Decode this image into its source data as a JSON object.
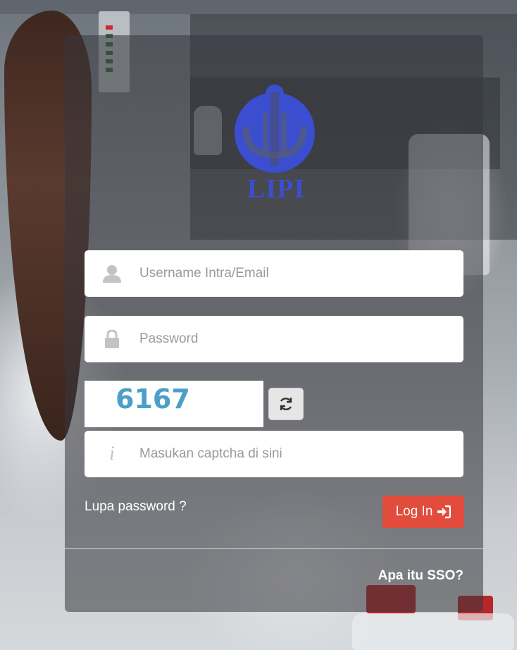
{
  "logo": {
    "text": "LIPI",
    "color": "#3b4ed0"
  },
  "form": {
    "username_placeholder": "Username Intra/Email",
    "password_placeholder": "Password",
    "captcha_text": "6167",
    "captcha_placeholder": "Masukan captcha di sini",
    "forgot_label": "Lupa password ?",
    "login_label": "Log In",
    "sso_label": "Apa itu SSO?"
  },
  "icons": {
    "username": "user-icon",
    "password": "lock-icon",
    "captcha": "info-icon",
    "refresh": "refresh-icon",
    "login": "sign-in-icon"
  },
  "colors": {
    "login_button": "#e14c3c",
    "captcha_text": "#4b9fc8"
  }
}
